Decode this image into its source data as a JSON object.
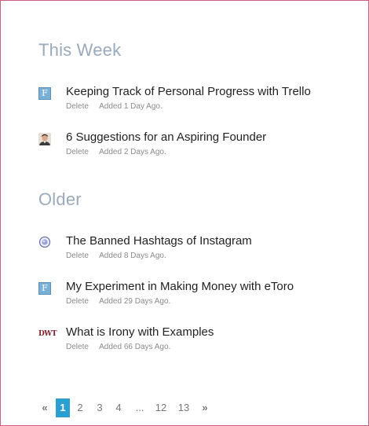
{
  "sections": [
    {
      "title": "This Week",
      "items": [
        {
          "icon": "letter-f-favicon-icon",
          "title": "Keeping Track of Personal Progress with Trello",
          "delete_label": "Delete",
          "added": "Added 1 Day Ago."
        },
        {
          "icon": "person-avatar-icon",
          "title": "6 Suggestions for an Aspiring Founder",
          "delete_label": "Delete",
          "added": "Added 2 Days Ago."
        }
      ]
    },
    {
      "title": "Older",
      "items": [
        {
          "icon": "globe-icon",
          "title": "The Banned Hashtags of Instagram",
          "delete_label": "Delete",
          "added": "Added 8 Days Ago."
        },
        {
          "icon": "letter-f-favicon-icon",
          "title": "My Experiment in Making Money with eToro",
          "delete_label": "Delete",
          "added": "Added 29 Days Ago."
        },
        {
          "icon": "dwt-logo-icon",
          "title": "What is Irony with Examples",
          "delete_label": "Delete",
          "added": "Added 66 Days Ago."
        }
      ]
    }
  ],
  "icons": {
    "f_letter": "F",
    "dwt_text": "DWT"
  },
  "pagination": {
    "prev": "«",
    "pages": [
      "1",
      "2",
      "3",
      "4"
    ],
    "ellipsis": "...",
    "last_pages": [
      "12",
      "13"
    ],
    "next": "»",
    "current": "1"
  },
  "colors": {
    "frame_border": "#c9607f",
    "section_title": "#9aaabb",
    "current_page": "#2a9fd0"
  }
}
